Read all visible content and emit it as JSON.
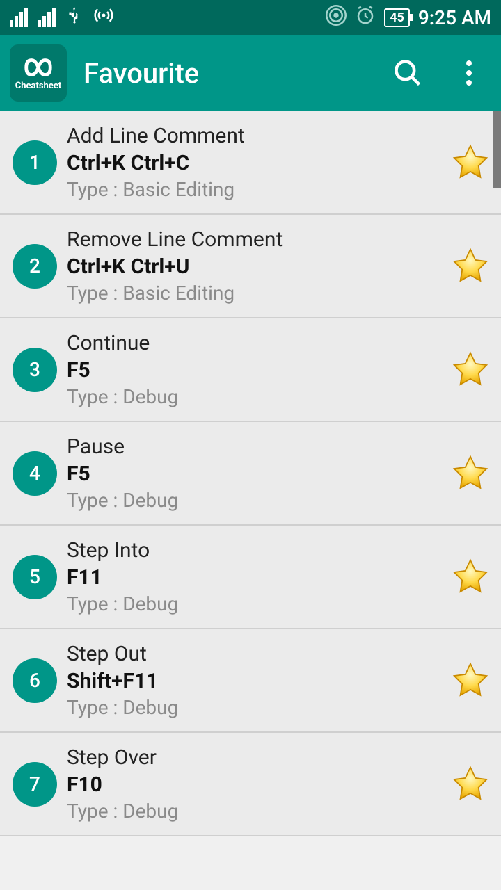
{
  "status": {
    "battery": "45",
    "time": "9:25 AM"
  },
  "appbar": {
    "icon_label": "Cheatsheet",
    "title": "Favourite"
  },
  "type_prefix": "Type : ",
  "items": [
    {
      "n": "1",
      "title": "Add Line Comment",
      "shortcut": "Ctrl+K Ctrl+C",
      "type": "Basic Editing"
    },
    {
      "n": "2",
      "title": "Remove Line Comment",
      "shortcut": "Ctrl+K Ctrl+U",
      "type": "Basic Editing"
    },
    {
      "n": "3",
      "title": "Continue",
      "shortcut": "F5",
      "type": "Debug"
    },
    {
      "n": "4",
      "title": "Pause",
      "shortcut": "F5",
      "type": "Debug"
    },
    {
      "n": "5",
      "title": "Step Into",
      "shortcut": "F11",
      "type": "Debug"
    },
    {
      "n": "6",
      "title": "Step Out",
      "shortcut": "Shift+F11",
      "type": "Debug"
    },
    {
      "n": "7",
      "title": "Step Over",
      "shortcut": "F10",
      "type": "Debug"
    }
  ]
}
